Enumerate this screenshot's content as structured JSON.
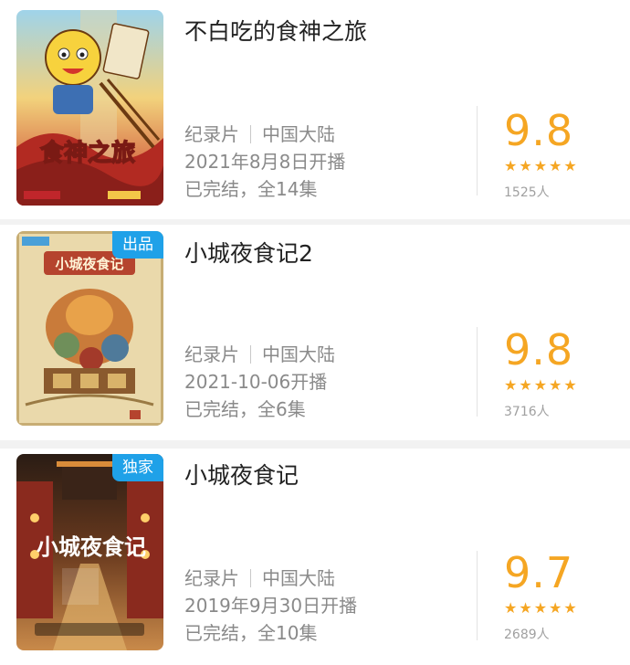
{
  "items": [
    {
      "title": "不白吃的食神之旅",
      "type": "纪录片",
      "region": "中国大陆",
      "release": "2021年8月8日开播",
      "status": "已完结，全14集",
      "score": "9.8",
      "stars": "★★★★★",
      "votes": "1525人",
      "badge": "",
      "poster_art_text": "食神之旅",
      "poster_palette": [
        "#d7442b",
        "#f3c748",
        "#8fcbe6"
      ]
    },
    {
      "title": "小城夜食记2",
      "type": "纪录片",
      "region": "中国大陆",
      "release": "2021-10-06开播",
      "status": "已完结，全6集",
      "score": "9.8",
      "stars": "★★★★★",
      "votes": "3716人",
      "badge": "出品",
      "poster_art_text": "小城夜食记",
      "poster_palette": [
        "#e8d6a6",
        "#b5442e",
        "#6f8f5a"
      ]
    },
    {
      "title": "小城夜食记",
      "type": "纪录片",
      "region": "中国大陆",
      "release": "2019年9月30日开播",
      "status": "已完结，全10集",
      "score": "9.7",
      "stars": "★★★★★",
      "votes": "2689人",
      "badge": "独家",
      "poster_art_text": "小城夜食记",
      "poster_palette": [
        "#3a2a1e",
        "#d98c3a",
        "#8a2a1e"
      ]
    }
  ]
}
